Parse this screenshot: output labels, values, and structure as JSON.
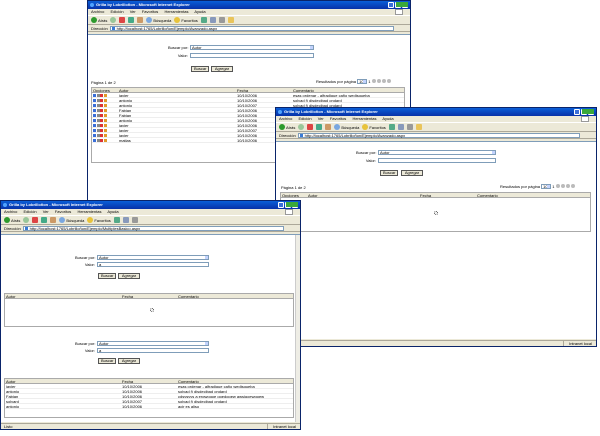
{
  "windows": {
    "title": "Grilla by Lobrilloñon - Microsoft Internet Explorer",
    "menu": [
      "Archivo",
      "Edición",
      "Ver",
      "Favoritos",
      "Herramientas",
      "Ayuda"
    ],
    "toolbar": {
      "back": "Atrás",
      "search": "Búsqueda",
      "favorites": "Favoritos"
    },
    "address_label": "Dirección",
    "status_text": "Listo",
    "zone": "Intranet local"
  },
  "window_a": {
    "url": "http://localhost:1765/Lobrilloñon/Ejemplo/Avanzado.aspx",
    "form": {
      "search_by_label": "Buscar por:",
      "search_by_value": "Autor",
      "value_label": "Valor:",
      "value": ""
    },
    "buttons": {
      "search": "Buscar",
      "add": "Agregar"
    },
    "pager": {
      "page_info": "Página 1 de 2",
      "results_label": "Resultados por página",
      "page_size": "10",
      "page_number": "1"
    },
    "columns": [
      "Opciones",
      "Autor",
      "Fecha",
      "Comentario"
    ],
    "rows": [
      {
        "autor": "javier",
        "fecha": "10/10/2006",
        "comentario": "esas ordenar - alfradique caño wedisqueba"
      },
      {
        "autor": "antonio",
        "fecha": "10/10/2006",
        "comentario": "solvad ñ disdecibad ondard"
      },
      {
        "autor": "antonio",
        "fecha": "10/10/2007",
        "comentario": "solvad ñ disdecibad ondard"
      },
      {
        "autor": "Fabian",
        "fecha": "10/10/2006",
        "comentario": ""
      },
      {
        "autor": "Fabian",
        "fecha": "10/10/2006",
        "comentario": ""
      },
      {
        "autor": "antonio",
        "fecha": "10/10/2006",
        "comentario": ""
      },
      {
        "autor": "javier",
        "fecha": "10/10/2006",
        "comentario": ""
      },
      {
        "autor": "javier",
        "fecha": "10/10/2007",
        "comentario": ""
      },
      {
        "autor": "javier",
        "fecha": "10/10/2006",
        "comentario": ""
      },
      {
        "autor": "matias",
        "fecha": "10/10/2006",
        "comentario": ""
      }
    ]
  },
  "window_b": {
    "url": "http://localhost:1765/Lobrilloñon/Ejemplo/Avanzado.aspx",
    "form": {
      "search_by_label": "Buscar por:",
      "search_by_value": "Autor",
      "value_label": "Valor:",
      "value": ""
    },
    "buttons": {
      "search": "Buscar",
      "add": "Agregar"
    },
    "pager": {
      "page_info": "Página 1 de 2",
      "results_label": "Resultados por página",
      "page_size": "10",
      "page_number": "1"
    },
    "columns": [
      "Opciones",
      "Autor",
      "Fecha",
      "Comentario"
    ]
  },
  "window_c": {
    "url": "http://localhost:1765/Lobrilloñon/Ejemplo/MultiplesBasico.aspx",
    "form1": {
      "search_by_label": "Buscar por:",
      "search_by_value": "Autor",
      "value_label": "Valor:",
      "value": "a"
    },
    "form2": {
      "search_by_label": "Buscar por:",
      "search_by_value": "Autor",
      "value_label": "Valor:",
      "value": "a"
    },
    "buttons": {
      "search": "Buscar",
      "add": "Agregar"
    },
    "columns": [
      "Autor",
      "Fecha",
      "Comentario"
    ],
    "rows": [
      {
        "autor": "javier",
        "fecha": "10/10/2006",
        "comentario": "esas ordenar - alfradique caño wedisqueba"
      },
      {
        "autor": "antonio",
        "fecha": "10/10/2006",
        "comentario": "solvad ñ disdecibad ondard"
      },
      {
        "autor": "Fabian",
        "fecha": "10/10/2006",
        "comentario": "cdsvsvvs a erqwoqoe qoedqoew awsiqoewqoew"
      },
      {
        "autor": "solvard",
        "fecha": "10/10/2007",
        "comentario": "solvad ñ disdecibad ondard"
      },
      {
        "autor": "antonio",
        "fecha": "10/10/2006",
        "comentario": "acir es aljso"
      }
    ]
  },
  "colors": {
    "title_bar": "#0831a8",
    "chrome": "#ece9d8",
    "border": "#7f9db9"
  }
}
